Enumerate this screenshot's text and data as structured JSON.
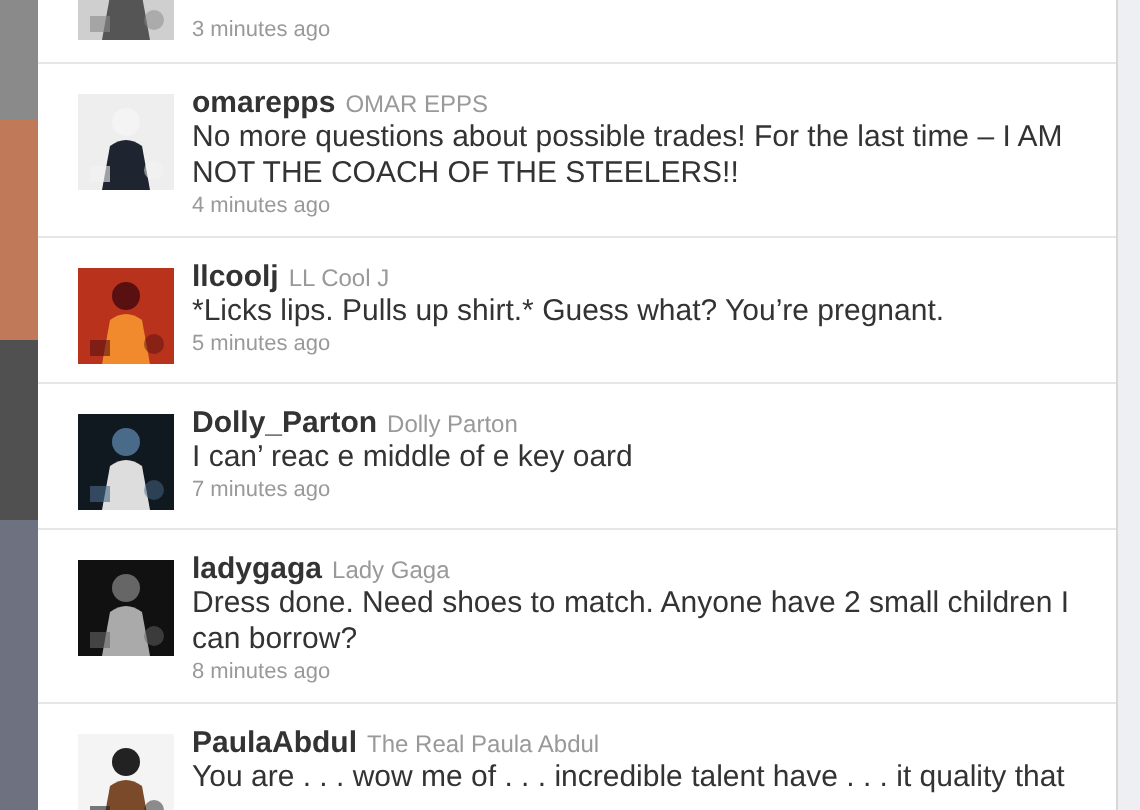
{
  "tweets": [
    {
      "kind": "partial",
      "time": "3 minutes ago"
    },
    {
      "kind": "full",
      "username": "omarepps",
      "display_name": "OMAR EPPS",
      "text": "No more questions about possible trades! For the last time – I AM NOT THE COACH OF THE STEELERS!!",
      "time": "4 minutes ago"
    },
    {
      "kind": "full",
      "username": "llcoolj",
      "display_name": "LL Cool J",
      "text": "*Licks lips. Pulls up shirt.* Guess what? You’re pregnant.",
      "time": "5 minutes ago"
    },
    {
      "kind": "full",
      "username": "Dolly_Parton",
      "display_name": "Dolly Parton",
      "text": "I can’ reac e middle of e key oard",
      "time": "7 minutes ago"
    },
    {
      "kind": "full",
      "username": "ladygaga",
      "display_name": "Lady Gaga",
      "text": "Dress done. Need shoes to match. Anyone have 2 small children I can borrow?",
      "time": "8 minutes ago"
    },
    {
      "kind": "full",
      "username": "PaulaAbdul",
      "display_name": "The Real Paula Abdul",
      "text": "You are . . . wow me of . . . incredible talent have . . . it quality that"
    }
  ]
}
